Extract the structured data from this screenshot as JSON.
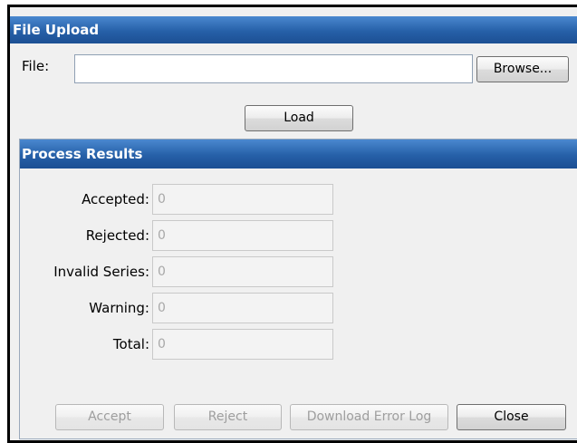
{
  "file_upload": {
    "title": "File Upload",
    "file_label": "File:",
    "file_value": "",
    "browse_label": "Browse...",
    "load_label": "Load"
  },
  "process_results": {
    "title": "Process Results",
    "rows": [
      {
        "label": "Accepted:",
        "value": "0"
      },
      {
        "label": "Rejected:",
        "value": "0"
      },
      {
        "label": "Invalid Series:",
        "value": "0"
      },
      {
        "label": "Warning:",
        "value": "0"
      },
      {
        "label": "Total:",
        "value": "0"
      }
    ]
  },
  "footer": {
    "accept_label": "Accept",
    "reject_label": "Reject",
    "download_label": "Download Error Log",
    "close_label": "Close"
  },
  "colors": {
    "header_blue": "#2660a8",
    "panel_bg": "#f0f0f0"
  }
}
